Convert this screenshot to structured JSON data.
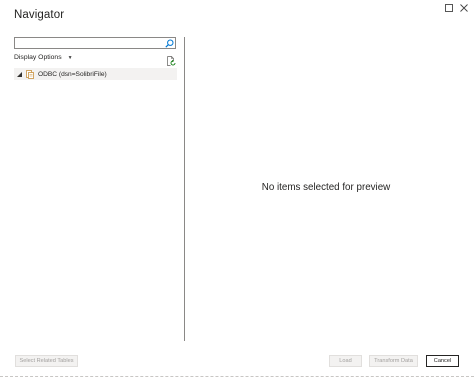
{
  "window": {
    "title": "Navigator",
    "maximize_icon": "maximize-icon",
    "close_icon": "close-icon"
  },
  "search": {
    "value": "",
    "placeholder": "",
    "icon": "search-icon"
  },
  "display_options": {
    "label": "Display Options",
    "icon": "chevron-down-icon"
  },
  "refresh": {
    "icon": "refresh-file-icon"
  },
  "tree": {
    "items": [
      {
        "label": "ODBC (dsn=SolibriFile)",
        "expanded": true,
        "icon": "odbc-source-icon"
      }
    ]
  },
  "preview": {
    "message": "No items selected for preview"
  },
  "footer": {
    "select_related": "Select Related Tables",
    "load": "Load",
    "transform": "Transform Data",
    "cancel": "Cancel"
  },
  "colors": {
    "border": "#8a8886",
    "selected_bg": "#f3f2f1",
    "disabled_text": "#a19f9d",
    "odbc_icon": "#c8903c",
    "search_icon": "#0078d4"
  }
}
